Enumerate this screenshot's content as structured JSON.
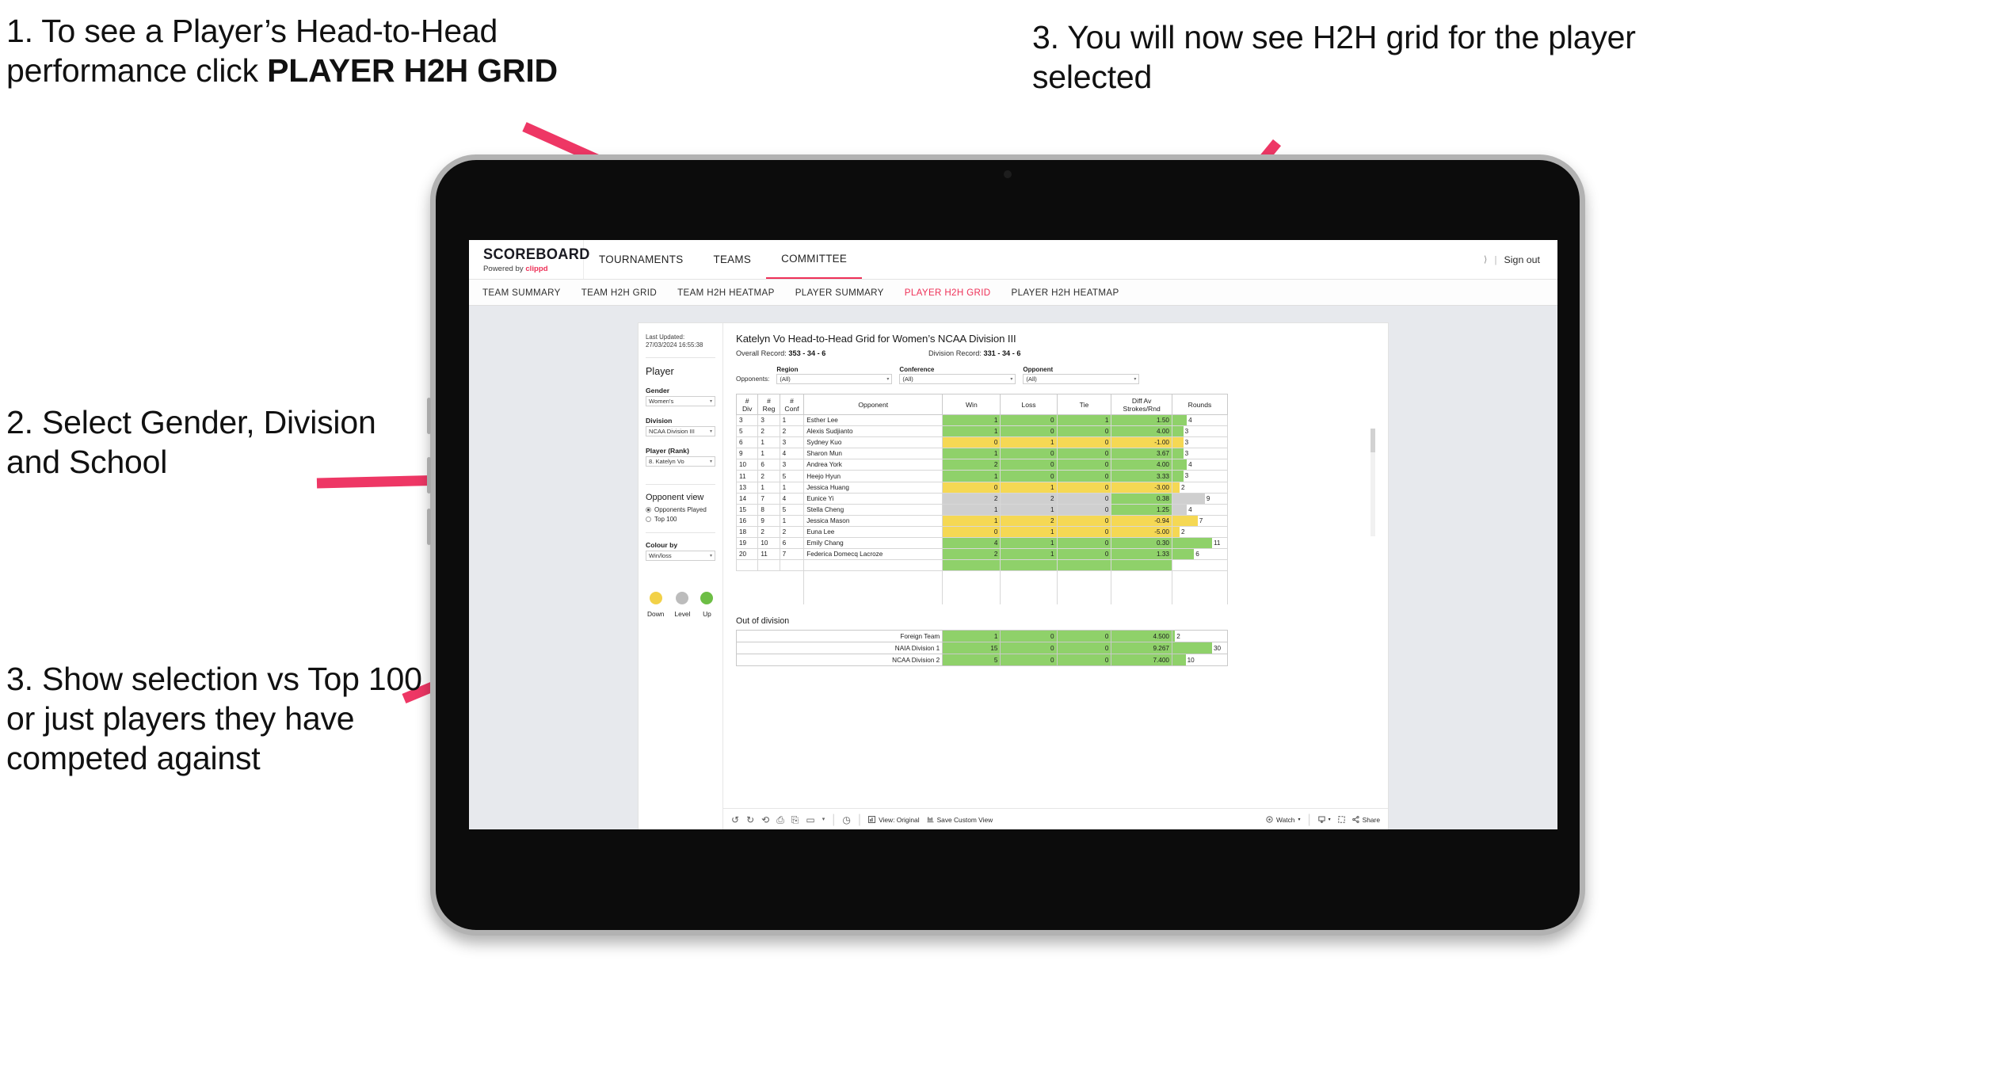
{
  "annotations": {
    "callout_1_line1": "1. To see a Player’s Head-to-Head performance click ",
    "callout_1_bold": "PLAYER H2H GRID",
    "callout_2": "2. Select Gender, Division and School",
    "callout_3": "3. Show selection vs Top 100 or just players they have competed against",
    "callout_4": "3. You will now see H2H grid for the player selected",
    "arrow_color": "#ee3765"
  },
  "topnav": {
    "brand_title": "SCOREBOARD",
    "brand_sub_prefix": "Powered by ",
    "brand_sub_brand": "clippd",
    "items": [
      {
        "label": "TOURNAMENTS",
        "active": false
      },
      {
        "label": "TEAMS",
        "active": false
      },
      {
        "label": "COMMITTEE",
        "active": true
      }
    ],
    "account_chevron": "⟩",
    "separator": "|",
    "sign_out": "Sign out"
  },
  "subnav": {
    "tabs": [
      {
        "label": "TEAM SUMMARY",
        "active": false
      },
      {
        "label": "TEAM H2H GRID",
        "active": false
      },
      {
        "label": "TEAM H2H HEATMAP",
        "active": false
      },
      {
        "label": "PLAYER SUMMARY",
        "active": false
      },
      {
        "label": "PLAYER H2H GRID",
        "active": true
      },
      {
        "label": "PLAYER H2H HEATMAP",
        "active": false
      }
    ],
    "active_color": "#ee3158"
  },
  "rail": {
    "last_updated": "Last Updated: 27/03/2024 16:55:38",
    "section_player": "Player",
    "filters": [
      {
        "label": "Gender",
        "value": "Women's"
      },
      {
        "label": "Division",
        "value": "NCAA Division III"
      },
      {
        "label": "Player (Rank)",
        "value": "8. Katelyn Vo"
      }
    ],
    "opponent_view_heading": "Opponent view",
    "opponent_view_options": [
      {
        "label": "Opponents Played",
        "selected": true
      },
      {
        "label": "Top 100",
        "selected": false
      }
    ],
    "colour_by_label": "Colour by",
    "colour_by_value": "Win/loss",
    "legend": [
      {
        "label": "Down",
        "color": "#f2d148"
      },
      {
        "label": "Level",
        "color": "#bcbcbc"
      },
      {
        "label": "Up",
        "color": "#6dbe45"
      }
    ],
    "caret": "▾"
  },
  "main": {
    "title": "Katelyn Vo Head-to-Head Grid for Women’s NCAA Division III",
    "overall_record_label": "Overall Record: ",
    "overall_record_value": "353 - 34 - 6",
    "division_record_label": "Division Record: ",
    "division_record_value": "331 - 34 - 6",
    "opponents_label": "Opponents:",
    "opponent_filters": [
      {
        "label": "Region",
        "value": "(All)"
      },
      {
        "label": "Conference",
        "value": "(All)"
      },
      {
        "label": "Opponent",
        "value": "(All)"
      }
    ],
    "caret": "▾"
  },
  "chart_data": {
    "type": "table",
    "title": "Katelyn Vo Head-to-Head Grid for Women’s NCAA Division III",
    "columns": [
      "# Div",
      "# Reg",
      "# Conf",
      "Opponent",
      "Win",
      "Loss",
      "Tie",
      "Diff Av Strokes/Rnd",
      "Rounds"
    ],
    "column_headers_multiline": [
      [
        "#",
        "Div"
      ],
      [
        "#",
        "Reg"
      ],
      [
        "#",
        "Conf"
      ],
      [
        "Opponent"
      ],
      [
        "Win"
      ],
      [
        "Loss"
      ],
      [
        "Tie"
      ],
      [
        "Diff Av",
        "Strokes/Rnd"
      ],
      [
        "Rounds"
      ]
    ],
    "rows": [
      {
        "div": "3",
        "reg": "3",
        "conf": "1",
        "opponent": "Esther Lee",
        "win": "1",
        "loss": "0",
        "tie": "1",
        "diff": "1.50",
        "rounds": "4",
        "state": "up"
      },
      {
        "div": "5",
        "reg": "2",
        "conf": "2",
        "opponent": "Alexis Sudjianto",
        "win": "1",
        "loss": "0",
        "tie": "0",
        "diff": "4.00",
        "rounds": "3",
        "state": "up"
      },
      {
        "div": "6",
        "reg": "1",
        "conf": "3",
        "opponent": "Sydney Kuo",
        "win": "0",
        "loss": "1",
        "tie": "0",
        "diff": "-1.00",
        "rounds": "3",
        "state": "down"
      },
      {
        "div": "9",
        "reg": "1",
        "conf": "4",
        "opponent": "Sharon Mun",
        "win": "1",
        "loss": "0",
        "tie": "0",
        "diff": "3.67",
        "rounds": "3",
        "state": "up"
      },
      {
        "div": "10",
        "reg": "6",
        "conf": "3",
        "opponent": "Andrea York",
        "win": "2",
        "loss": "0",
        "tie": "0",
        "diff": "4.00",
        "rounds": "4",
        "state": "up"
      },
      {
        "div": "11",
        "reg": "2",
        "conf": "5",
        "opponent": "Heejo Hyun",
        "win": "1",
        "loss": "0",
        "tie": "0",
        "diff": "3.33",
        "rounds": "3",
        "state": "up"
      },
      {
        "div": "13",
        "reg": "1",
        "conf": "1",
        "opponent": "Jessica Huang",
        "win": "0",
        "loss": "1",
        "tie": "0",
        "diff": "-3.00",
        "rounds": "2",
        "state": "down"
      },
      {
        "div": "14",
        "reg": "7",
        "conf": "4",
        "opponent": "Eunice Yi",
        "win": "2",
        "loss": "2",
        "tie": "0",
        "diff": "0.38",
        "rounds": "9",
        "state": "level",
        "diff_state": "up"
      },
      {
        "div": "15",
        "reg": "8",
        "conf": "5",
        "opponent": "Stella Cheng",
        "win": "1",
        "loss": "1",
        "tie": "0",
        "diff": "1.25",
        "rounds": "4",
        "state": "level",
        "diff_state": "up"
      },
      {
        "div": "16",
        "reg": "9",
        "conf": "1",
        "opponent": "Jessica Mason",
        "win": "1",
        "loss": "2",
        "tie": "0",
        "diff": "-0.94",
        "rounds": "7",
        "state": "down"
      },
      {
        "div": "18",
        "reg": "2",
        "conf": "2",
        "opponent": "Euna Lee",
        "win": "0",
        "loss": "1",
        "tie": "0",
        "diff": "-5.00",
        "rounds": "2",
        "state": "down"
      },
      {
        "div": "19",
        "reg": "10",
        "conf": "6",
        "opponent": "Emily Chang",
        "win": "4",
        "loss": "1",
        "tie": "0",
        "diff": "0.30",
        "rounds": "11",
        "state": "up"
      },
      {
        "div": "20",
        "reg": "11",
        "conf": "7",
        "opponent": "Federica Domecq Lacroze",
        "win": "2",
        "loss": "1",
        "tie": "0",
        "diff": "1.33",
        "rounds": "6",
        "state": "up"
      }
    ],
    "rounds_max": 11,
    "out_of_division_heading": "Out of division",
    "out_of_division_rows": [
      {
        "name": "Foreign Team",
        "win": "1",
        "loss": "0",
        "tie": "0",
        "diff": "4.500",
        "rounds": "2",
        "state": "up"
      },
      {
        "name": "NAIA Division 1",
        "win": "15",
        "loss": "0",
        "tie": "0",
        "diff": "9.267",
        "rounds": "30",
        "state": "up"
      },
      {
        "name": "NCAA Division 2",
        "win": "5",
        "loss": "0",
        "tie": "0",
        "diff": "7.400",
        "rounds": "10",
        "state": "up"
      }
    ],
    "out_of_division_rounds_max": 30,
    "colors": {
      "up": "#8fd16a",
      "down": "#f5d854",
      "level": "#cfcfcf"
    }
  },
  "toolbar": {
    "view_label": "View: Original",
    "save_label": "Save Custom View",
    "watch_label": "Watch",
    "share_label": "Share",
    "caret": "▾",
    "pipe": "|"
  }
}
